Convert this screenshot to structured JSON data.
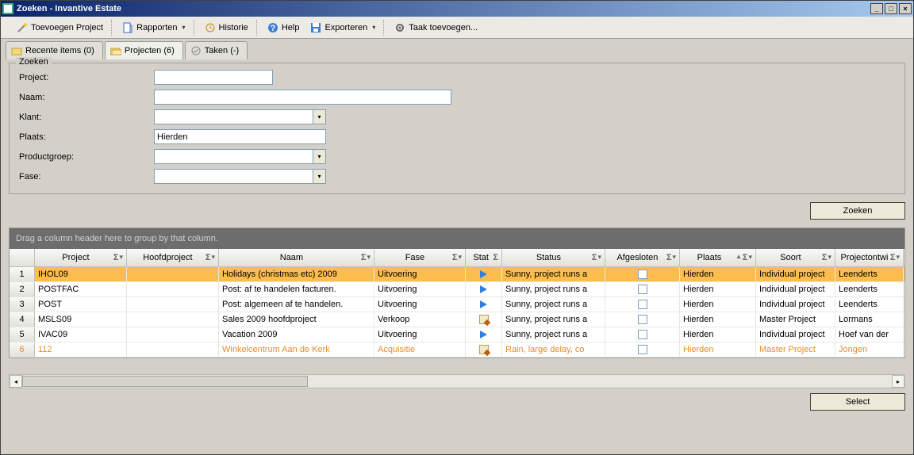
{
  "window": {
    "title": "Zoeken - Invantive Estate"
  },
  "toolbar": {
    "add_project": "Toevoegen Project",
    "reports": "Rapporten",
    "history": "Historie",
    "help": "Help",
    "export": "Exporteren",
    "add_task": "Taak toevoegen..."
  },
  "tabs": {
    "recent": "Recente items (0)",
    "projects": "Projecten (6)",
    "tasks": "Taken (-)"
  },
  "search": {
    "legend": "Zoeken",
    "labels": {
      "project": "Project:",
      "naam": "Naam:",
      "klant": "Klant:",
      "plaats": "Plaats:",
      "productgroep": "Productgroep:",
      "fase": "Fase:"
    },
    "values": {
      "project": "",
      "naam": "",
      "klant": "",
      "plaats": "Hierden",
      "productgroep": "",
      "fase": ""
    },
    "button": "Zoeken"
  },
  "grid": {
    "group_hint": "Drag a column header here to group by that column.",
    "columns": {
      "project": "Project",
      "hoofdproject": "Hoofdproject",
      "naam": "Naam",
      "fase": "Fase",
      "stat": "Stat",
      "status": "Status",
      "afgesloten": "Afgesloten",
      "plaats": "Plaats",
      "soort": "Soort",
      "projectontw": "Projectontwi"
    },
    "rows": [
      {
        "n": "1",
        "project": "IHOL09",
        "hoofd": "",
        "naam": "Holidays (christmas etc) 2009",
        "fase": "Uitvoering",
        "stat": "play",
        "status": "Sunny, project runs a",
        "afg": false,
        "plaats": "Hierden",
        "soort": "Individual project",
        "ontw": "Leenderts",
        "sel": true
      },
      {
        "n": "2",
        "project": "POSTFAC",
        "hoofd": "",
        "naam": "Post: af te handelen facturen.",
        "fase": "Uitvoering",
        "stat": "play",
        "status": "Sunny, project runs a",
        "afg": false,
        "plaats": "Hierden",
        "soort": "Individual project",
        "ontw": "Leenderts",
        "sel": false
      },
      {
        "n": "3",
        "project": "POST",
        "hoofd": "",
        "naam": "Post: algemeen af te handelen.",
        "fase": "Uitvoering",
        "stat": "play",
        "status": "Sunny, project runs a",
        "afg": false,
        "plaats": "Hierden",
        "soort": "Individual project",
        "ontw": "Leenderts",
        "sel": false
      },
      {
        "n": "4",
        "project": "MSLS09",
        "hoofd": "",
        "naam": "Sales 2009 hoofdproject",
        "fase": "Verkoop",
        "stat": "edit",
        "status": "Sunny, project runs a",
        "afg": false,
        "plaats": "Hierden",
        "soort": "Master Project",
        "ontw": "Lormans",
        "sel": false
      },
      {
        "n": "5",
        "project": "IVAC09",
        "hoofd": "",
        "naam": "Vacation 2009",
        "fase": "Uitvoering",
        "stat": "play",
        "status": "Sunny, project runs a",
        "afg": false,
        "plaats": "Hierden",
        "soort": "Individual project",
        "ontw": "Hoef van der",
        "sel": false
      },
      {
        "n": "6",
        "project": "112",
        "hoofd": "",
        "naam": "Winkelcentrum Aan de Kerk",
        "fase": "Acquisitie",
        "stat": "edit",
        "status": "Rain, large delay, co",
        "afg": false,
        "plaats": "Hierden",
        "soort": "Master Project",
        "ontw": "Jongen",
        "sel": false,
        "orange": true
      }
    ],
    "select_button": "Select"
  }
}
